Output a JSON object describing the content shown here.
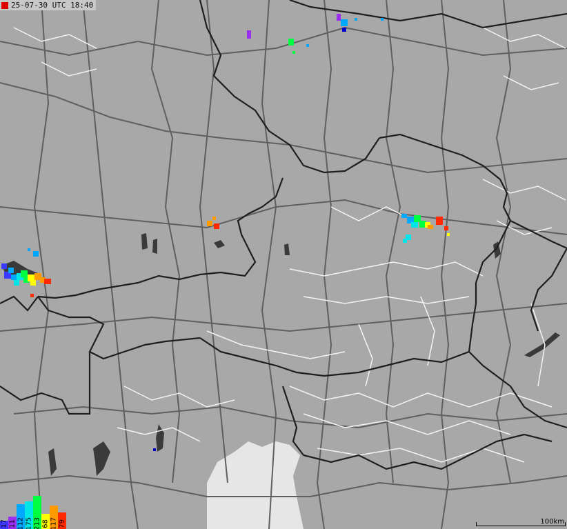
{
  "timestamp": {
    "text": "25-07-30 UTC 18:40",
    "live_color": "#e00000"
  },
  "scale": {
    "label": "100km"
  },
  "colors": {
    "land": "#a8a8a8",
    "sea": "#e6e6e6",
    "lakes": "#3a3a3a",
    "borders": "#1e1e1e",
    "roads": "#5f5f5f",
    "regions": "#f4f4f4"
  },
  "legend": [
    {
      "count": "17",
      "color": "#3a3aff"
    },
    {
      "count": "11",
      "color": "#9b2ff0"
    },
    {
      "count": "112",
      "color": "#00a8ff"
    },
    {
      "count": "175",
      "color": "#00e6e6"
    },
    {
      "count": "213",
      "color": "#00ff40"
    },
    {
      "count": "68",
      "color": "#ffff00"
    },
    {
      "count": "117",
      "color": "#ff9a00"
    },
    {
      "count": "79",
      "color": "#ff2a00"
    }
  ]
}
